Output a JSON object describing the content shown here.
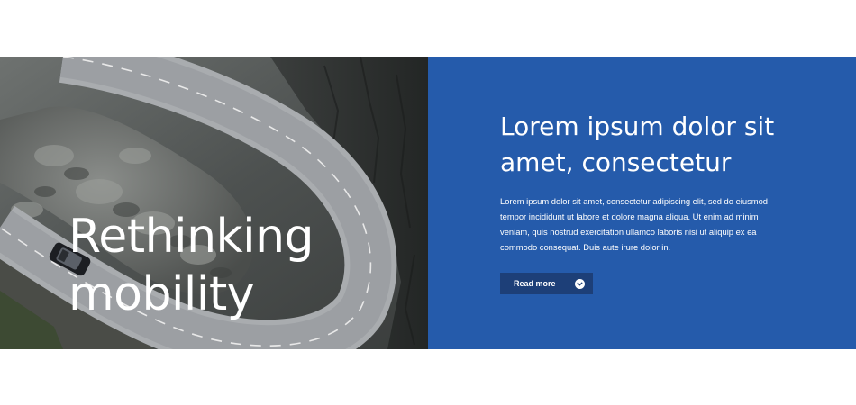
{
  "hero": {
    "heading_line1": "Rethinking",
    "heading_line2": "mobility",
    "image_icon": "mountain-road-photo"
  },
  "panel": {
    "title_line1": "Lorem ipsum dolor sit",
    "title_line2": "amet, consectetur",
    "body_line1": "Lorem ipsum dolor sit amet, consectetur adipiscing elit, sed do eiusmod",
    "body_line2": "tempor incididunt ut labore et dolore magna aliqua. Ut enim ad minim",
    "body_line3": "veniam, quis nostrud exercitation ullamco laboris nisi ut aliquip ex ea",
    "body_line4": "commodo consequat. Duis aute irure dolor in.",
    "read_more_label": "Read more",
    "read_more_icon": "chevron-down-icon"
  },
  "colors": {
    "panel_bg": "#255bab",
    "button_bg": "#1d3f78",
    "text": "#ffffff"
  }
}
